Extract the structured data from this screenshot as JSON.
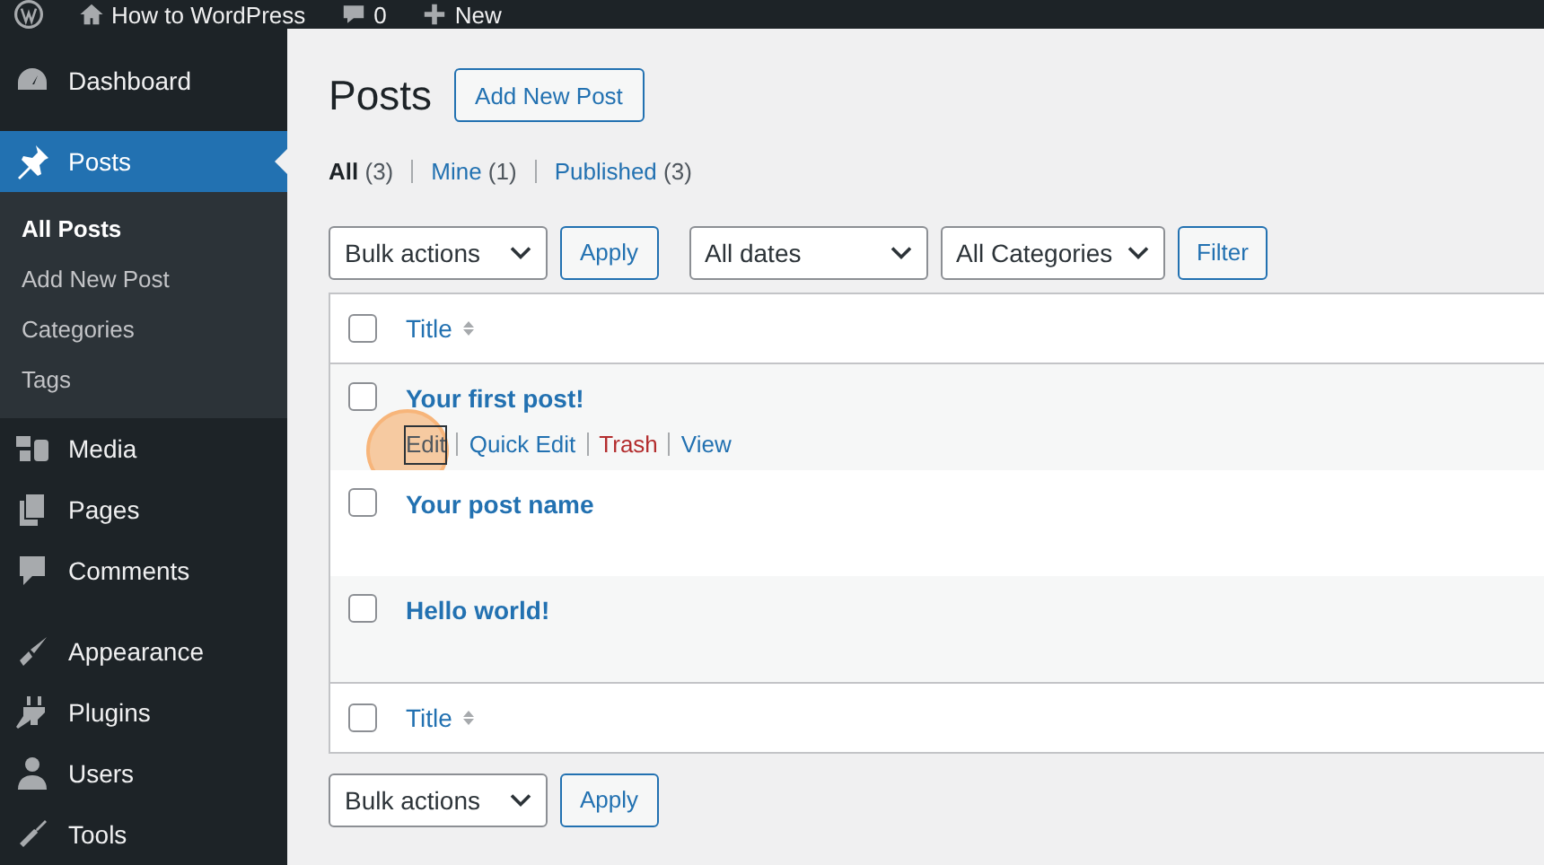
{
  "admin_bar": {
    "items": [
      {
        "kind": "logo"
      },
      {
        "kind": "site",
        "label": "How to WordPress"
      },
      {
        "kind": "comments",
        "label": "0"
      },
      {
        "kind": "new",
        "label": "New"
      }
    ]
  },
  "sidebar": {
    "groups": [
      [
        {
          "label": "Dashboard",
          "selected": false
        }
      ],
      [
        {
          "label": "Posts",
          "selected": true,
          "children": [
            {
              "label": "All Posts",
              "selected": true
            },
            {
              "label": "Add New Post",
              "selected": false
            },
            {
              "label": "Categories",
              "selected": false
            },
            {
              "label": "Tags",
              "selected": false
            }
          ]
        },
        {
          "label": "Media",
          "selected": false
        },
        {
          "label": "Pages",
          "selected": false
        },
        {
          "label": "Comments",
          "selected": false
        }
      ],
      [
        {
          "label": "Appearance",
          "selected": false
        },
        {
          "label": "Plugins",
          "selected": false
        },
        {
          "label": "Users",
          "selected": false
        },
        {
          "label": "Tools",
          "selected": false
        }
      ]
    ]
  },
  "page": {
    "title": "Posts",
    "add_button": "Add New Post"
  },
  "views": [
    {
      "label": "All",
      "count": "(3)",
      "selected": true
    },
    {
      "label": "Mine",
      "count": "(1)",
      "selected": false
    },
    {
      "label": "Published",
      "count": "(3)",
      "selected": false
    }
  ],
  "top_toolbar": {
    "bulk_select": "Bulk actions",
    "apply": "Apply",
    "date_select": "All dates",
    "category_select": "All Categories",
    "filter": "Filter"
  },
  "table": {
    "header": {
      "label": "Title",
      "checked": false
    },
    "rows": [
      {
        "title": "Your first post!",
        "checked": false,
        "actions": [
          {
            "label": "Edit",
            "kind": "normal",
            "highlighted": true
          },
          {
            "label": "Quick Edit",
            "kind": "normal",
            "highlighted": false
          },
          {
            "label": "Trash",
            "kind": "delete",
            "highlighted": false
          },
          {
            "label": "View",
            "kind": "normal",
            "highlighted": false
          }
        ]
      },
      {
        "title": "Your post name",
        "checked": false
      },
      {
        "title": "Hello world!",
        "checked": false
      }
    ],
    "footer": {
      "label": "Title",
      "checked": false
    }
  },
  "bottom_toolbar": {
    "bulk_select": "Bulk actions",
    "apply": "Apply"
  }
}
